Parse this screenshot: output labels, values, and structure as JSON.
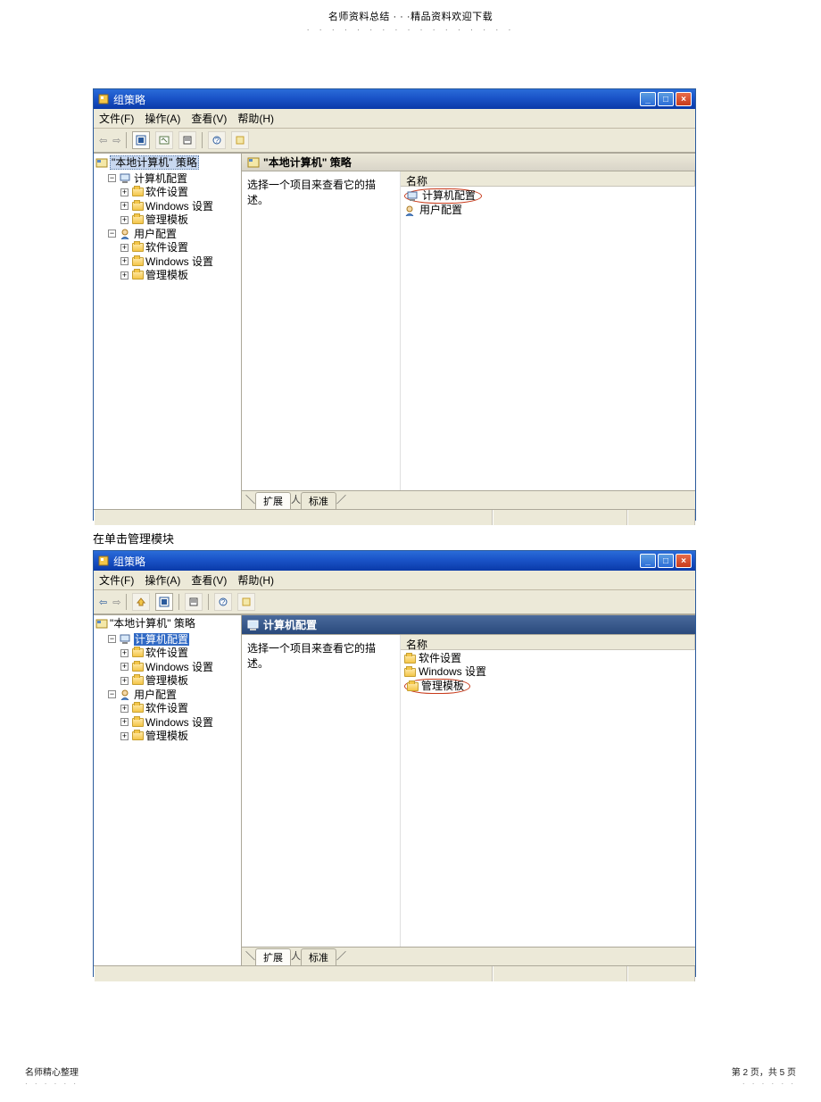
{
  "header": {
    "text": "名师资料总结 · · ·精品资料欢迎下载",
    "dots": "· · · · · · · · · · · · · · · · ·"
  },
  "win1": {
    "title": "组策略",
    "menus": {
      "file": "文件(F)",
      "action": "操作(A)",
      "view": "查看(V)",
      "help": "帮助(H)"
    },
    "tree": {
      "root": "\"本地计算机\" 策略",
      "computer": "计算机配置",
      "software": "软件设置",
      "windows": "Windows 设置",
      "admin": "管理模板",
      "user": "用户配置"
    },
    "pane": {
      "title": "\"本地计算机\" 策略",
      "desc": "选择一个项目来查看它的描述。",
      "col": "名称",
      "item1": "计算机配置",
      "item2": "用户配置"
    },
    "tabs": {
      "ext": "扩展",
      "std": "标准"
    }
  },
  "caption": "在单击管理模块",
  "win2": {
    "title": "组策略",
    "menus": {
      "file": "文件(F)",
      "action": "操作(A)",
      "view": "查看(V)",
      "help": "帮助(H)"
    },
    "tree": {
      "root": "\"本地计算机\" 策略",
      "computer": "计算机配置",
      "software": "软件设置",
      "windows": "Windows 设置",
      "admin": "管理模板",
      "user": "用户配置"
    },
    "pane": {
      "title": "计算机配置",
      "desc": "选择一个项目来查看它的描述。",
      "col": "名称",
      "item1": "软件设置",
      "item2": "Windows 设置",
      "item3": "管理模板"
    },
    "tabs": {
      "ext": "扩展",
      "std": "标准"
    }
  },
  "footer": {
    "left": "名师精心整理",
    "right": "第 2 页，共 5 页",
    "dots": "· · · · · ·"
  }
}
